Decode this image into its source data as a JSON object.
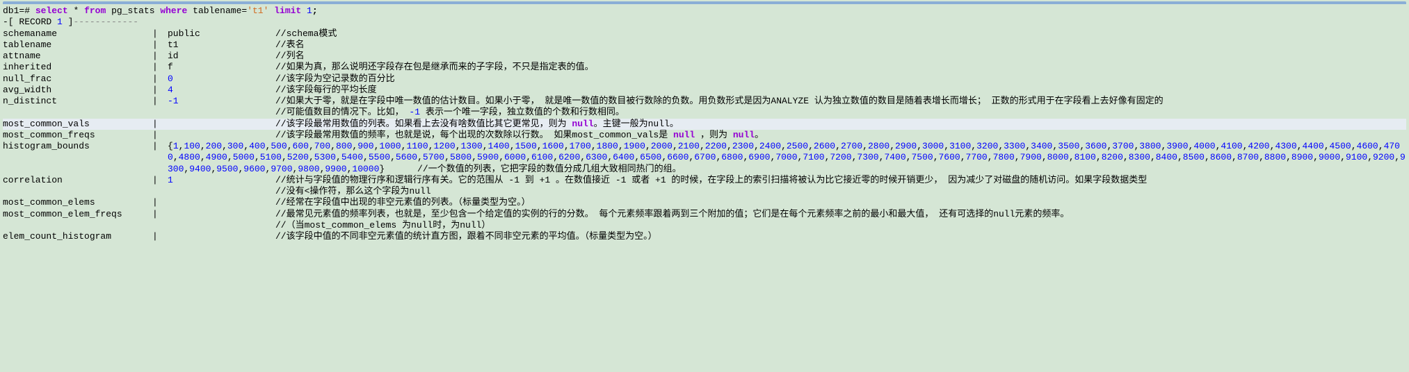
{
  "prompt": "db1=# ",
  "sql": {
    "select": "select",
    "star": "*",
    "from": "from",
    "table_src": "pg_stats",
    "where": "where",
    "cond_col": "tablename",
    "eq": "=",
    "cond_val": "'t1'",
    "limit": "limit",
    "limit_n": "1",
    "semi": ";"
  },
  "record_header": {
    "prefix": "-[ RECORD ",
    "num": "1",
    "suffix": " ]"
  },
  "rows": [
    {
      "field": "schemaname",
      "value": "public",
      "value_kind": "text",
      "comment": "//schema模式"
    },
    {
      "field": "tablename",
      "value": "t1",
      "value_kind": "text",
      "comment": "//表名"
    },
    {
      "field": "attname",
      "value": "id",
      "value_kind": "text",
      "comment": "//列名"
    },
    {
      "field": "inherited",
      "value": "f",
      "value_kind": "text",
      "comment": "//如果为真，那么说明还字段存在包是继承而来的子字段，不只是指定表的值。"
    },
    {
      "field": "null_frac",
      "value": "0",
      "value_kind": "num",
      "comment": "//该字段为空记录数的百分比"
    },
    {
      "field": "avg_width",
      "value": "4",
      "value_kind": "num",
      "comment": "//该字段每行的平均长度"
    },
    {
      "field": "n_distinct",
      "value": "-1",
      "value_kind": "num",
      "comment_parts": [
        "//如果大于零，就是在字段中唯一数值的估计数目。如果小于零， 就是唯一数值的数目被行数除的负数。用负数形式是因为ANALYZE 认为独立数值的数目是随着表增长而增长； 正数的形式用于在字段看上去好像有固定的",
        "//可能值数目的情况下。比如，",
        " -1 ",
        "表示一个唯一字段，独立数值的个数和行数相同。"
      ]
    },
    {
      "field": "most_common_vals",
      "value": "",
      "value_kind": "none",
      "highlight": true,
      "comment_parts": [
        "//该字段最常用数值的列表。如果看上去没有啥数值比其它更常见，则为 ",
        "null",
        "。主键一般为null。"
      ]
    },
    {
      "field": "most_common_freqs",
      "value": "",
      "value_kind": "none",
      "comment_parts": [
        "//该字段最常用数值的频率，也就是说，每个出现的次数除以行数。 如果most_common_vals是 ",
        "null",
        " ，则为 ",
        "null",
        "。"
      ]
    },
    {
      "field": "histogram_bounds",
      "value_kind": "hist",
      "hist_values": [
        1,
        100,
        200,
        300,
        400,
        500,
        600,
        700,
        800,
        900,
        1000,
        1100,
        1200,
        1300,
        1400,
        1500,
        1600,
        1700,
        1800,
        1900,
        2000,
        2100,
        2200,
        2300,
        2400,
        2500,
        2600,
        2700,
        2800,
        2900,
        3000,
        3100,
        3200,
        3300,
        3400,
        3500,
        3600,
        3700,
        3800,
        3900,
        4000,
        4100,
        4200,
        4300,
        4400,
        4500,
        4600,
        4700,
        4800,
        4900,
        5000,
        5100,
        5200,
        5300,
        5400,
        5500,
        5600,
        5700,
        5800,
        5900,
        6000,
        6100,
        6200,
        6300,
        6400,
        6500,
        6600,
        6700,
        6800,
        6900,
        7000,
        7100,
        7200,
        7300,
        7400,
        7500,
        7600,
        7700,
        7800,
        7900,
        8000,
        8100,
        8200,
        8300,
        8400,
        8500,
        8600,
        8700,
        8800,
        8900,
        9000,
        9100,
        9200,
        9300,
        9400,
        9500,
        9600,
        9700,
        9800,
        9900,
        10000
      ],
      "hist_trail_comment": "      //一个数值的列表，它把字段的数值分成几组大致相同热门的组。"
    },
    {
      "field": "correlation",
      "value": "1",
      "value_kind": "num",
      "extra_lines": [
        "//统计与字段值的物理行序和逻辑行序有关。它的范围从 -1 到 +1 。在数值接近 -1 或者 +1 的时候，在字段上的索引扫描将被认为比它接近零的时候开销更少， 因为减少了对磁盘的随机访问。如果字段数据类型",
        "//没有<操作符，那么这个字段为null"
      ]
    },
    {
      "field": "most_common_elems",
      "value": "",
      "value_kind": "none",
      "comment": "//经常在字段值中出现的非空元素值的列表。（标量类型为空。）"
    },
    {
      "field": "most_common_elem_freqs",
      "value": "",
      "value_kind": "none",
      "extra_lines": [
        "//最常见元素值的频率列表，也就是，至少包含一个给定值的实例的行的分数。 每个元素频率跟着两到三个附加的值；它们是在每个元素频率之前的最小和最大值， 还有可选择的null元素的频率。",
        "//（当most_common_elems 为null时，为null）"
      ]
    },
    {
      "field": "elem_count_histogram",
      "value": "",
      "value_kind": "none",
      "comment": "//该字段中值的不同非空元素值的统计直方图，跟着不同非空元素的平均值。（标量类型为空。）"
    }
  ]
}
